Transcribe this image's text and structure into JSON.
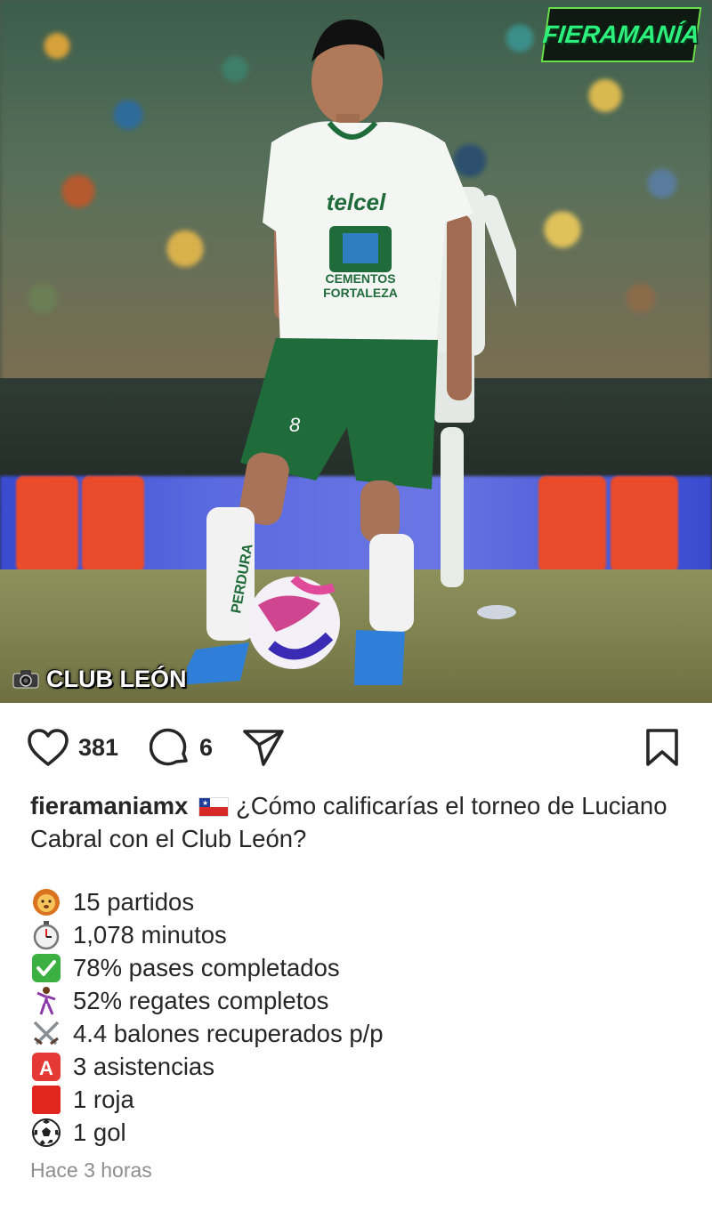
{
  "post": {
    "photo": {
      "logo_text": "FIERAMANÍA",
      "credit": "CLUB LEÓN",
      "jersey_sponsor": "telcel",
      "jersey_sponsor2": "CEMENTOS FORTALEZA"
    },
    "actions": {
      "likes": "381",
      "comments": "6"
    },
    "caption": {
      "username": "fieramaniamx",
      "text": "¿Cómo calificarías el torneo de Luciano Cabral con el Club León?"
    },
    "stats": [
      {
        "icon": "lion-icon",
        "text": "15 partidos"
      },
      {
        "icon": "stopwatch-icon",
        "text": "1,078 minutos"
      },
      {
        "icon": "check-icon",
        "text": "78% pases completados"
      },
      {
        "icon": "dancer-icon",
        "text": "52% regates completos"
      },
      {
        "icon": "crossed-swords-icon",
        "text": "4.4 balones recuperados p/p"
      },
      {
        "icon": "a-button-icon",
        "text": "3 asistencias"
      },
      {
        "icon": "red-square-icon",
        "text": "1 roja"
      },
      {
        "icon": "soccer-ball-icon",
        "text": "1 gol"
      }
    ],
    "timestamp": "Hace 3 horas"
  },
  "colors": {
    "text": "#262626",
    "muted": "#8e8e8e",
    "logo_green": "#2cf07b",
    "kit_green": "#1f6b3a"
  }
}
